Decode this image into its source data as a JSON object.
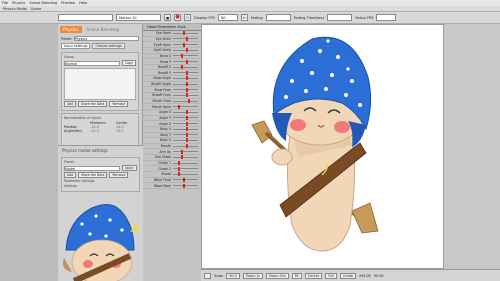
{
  "menubar": {
    "items": [
      "File",
      "Physics",
      "Scene Blending",
      "Preview",
      "Help"
    ]
  },
  "tabbar": {
    "tabs": [
      "Physics Model",
      "Scene"
    ]
  },
  "toolbar": {
    "model_select": "",
    "motion_select": "Motion A1",
    "fps_label": "Display FPS",
    "fps_value": "60",
    "fade_label": "Fading",
    "fade_value": "",
    "blend_label": "Fading Time(sec)",
    "blend_value": "",
    "extra_label": "Setup FPS",
    "extra_value": ""
  },
  "left_panel": {
    "tabs": [
      "Physics",
      "Scene Blending"
    ],
    "preset_label": "Preset",
    "preset_value": "Physics",
    "subtabs": [
      "Input settings",
      "Output settings"
    ],
    "group1_title": "Group",
    "group1_value": "Normal",
    "group1_btn": "Copy",
    "buttons_row": [
      "Add",
      "Store the Data",
      "Remove"
    ],
    "normalize_title": "Normalization of inputs",
    "min_label": "Minimum",
    "max_label": "Center",
    "pos_label": "Position",
    "pos_min": "-10.0",
    "pos_max": "10.0",
    "angle_label": "Angle(Sec)",
    "angle_min": "-10.0",
    "angle_max": "10.0"
  },
  "preview_panel": {
    "title": "Physics model settings",
    "group_label": "Preset",
    "group_value": "Model",
    "btn": "Apply",
    "buttons_row": [
      "Add",
      "Store the Data",
      "Remove"
    ],
    "section": "Parameter settings",
    "section2": "Settings"
  },
  "param_header": "Head Parameter Area",
  "params": [
    {
      "name": "Eye Open",
      "pos": 0.4
    },
    {
      "name": "Eye Smile",
      "pos": 0.5
    },
    {
      "name": "EyeR Open",
      "pos": 0.4
    },
    {
      "name": "EyeR Smile",
      "pos": 0.5
    },
    {
      "name": "Brow X",
      "pos": 0.3
    },
    {
      "name": "Brow Y",
      "pos": 0.5
    },
    {
      "name": "BrowR X",
      "pos": 0.3
    },
    {
      "name": "BrowR Y",
      "pos": 0.5
    },
    {
      "name": "Brow Angle",
      "pos": 0.5
    },
    {
      "name": "BrowR Angle",
      "pos": 0.5
    },
    {
      "name": "Brow Form",
      "pos": 0.5
    },
    {
      "name": "BrowR Form",
      "pos": 0.5
    },
    {
      "name": "Mouth Form",
      "pos": 0.6
    },
    {
      "name": "Mouth Open",
      "pos": 0.2
    },
    {
      "name": "Angle X",
      "pos": 0.5
    },
    {
      "name": "Angle Y",
      "pos": 0.5
    },
    {
      "name": "Angle Z",
      "pos": 0.5
    },
    {
      "name": "Body X",
      "pos": 0.5
    },
    {
      "name": "Body Y",
      "pos": 0.5
    },
    {
      "name": "Body Z",
      "pos": 0.5
    },
    {
      "name": "Breath",
      "pos": 0.5
    },
    {
      "name": "Arm Up",
      "pos": 0.3
    },
    {
      "name": "Arm Down",
      "pos": 0.3
    },
    {
      "name": "Cheek 1",
      "pos": 0.2
    },
    {
      "name": "Cheek 2",
      "pos": 0.2
    },
    {
      "name": "Shade",
      "pos": 0.2
    },
    {
      "name": "Wave Front",
      "pos": 0.4
    },
    {
      "name": "Wave Back",
      "pos": 0.4
    }
  ],
  "statusbar": {
    "scale_label": "Scale",
    "scale_value": "90.0",
    "zoom_in": "Zoom In",
    "zoom_out": "Zoom Out",
    "fit": "Fit",
    "center": "Center",
    "full": "Full",
    "guide": "Guide",
    "coords": "294.00",
    "coords2": "90.00"
  },
  "colors": {
    "accent": "#f08a3b",
    "hat_blue": "#2b6fd6",
    "skin": "#f2d6b8",
    "belt": "#7a4a24",
    "record": "#d22222"
  }
}
